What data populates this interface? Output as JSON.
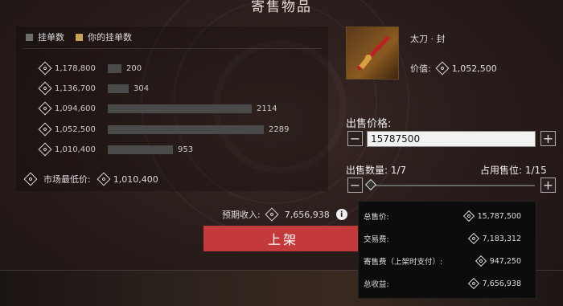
{
  "title": "寄售物品",
  "legend": {
    "orders": "挂单数",
    "mine": "你的挂单数"
  },
  "orders": [
    {
      "price": "1,178,800",
      "count": "200",
      "fraction": 0.087
    },
    {
      "price": "1,136,700",
      "count": "304",
      "fraction": 0.133
    },
    {
      "price": "1,094,600",
      "count": "2114",
      "fraction": 0.924
    },
    {
      "price": "1,052,500",
      "count": "2289",
      "fraction": 1.0
    },
    {
      "price": "1,010,400",
      "count": "953",
      "fraction": 0.416
    }
  ],
  "market": {
    "label": "市场最低价:",
    "value": "1,010,400"
  },
  "item": {
    "name": "太刀 · 封",
    "price_label": "价值:",
    "price": "1,052,500"
  },
  "sell": {
    "label": "出售价格:",
    "value": "15787500"
  },
  "quantity": {
    "label": "出售数量: 1/7",
    "slots_label": "占用售位: 1/15",
    "level": 0.143
  },
  "expected": {
    "label": "预期收入:",
    "value": "7,656,938"
  },
  "list_button": "上架",
  "popup": [
    {
      "label": "总售价:",
      "value": "15,787,500"
    },
    {
      "label": "交易费:",
      "value": "7,183,312"
    },
    {
      "label": "寄售费（上架时支付）:",
      "value": "947,250"
    },
    {
      "label": "总收益:",
      "value": "7,656,938"
    }
  ],
  "colors": {
    "accent": "#c43a3a",
    "gold": "#c9a15b",
    "bar": "#4a4a4a"
  },
  "icons": {
    "currency": "currency-icon",
    "plus": "plus-icon",
    "minus": "minus-icon",
    "info": "info-icon"
  }
}
